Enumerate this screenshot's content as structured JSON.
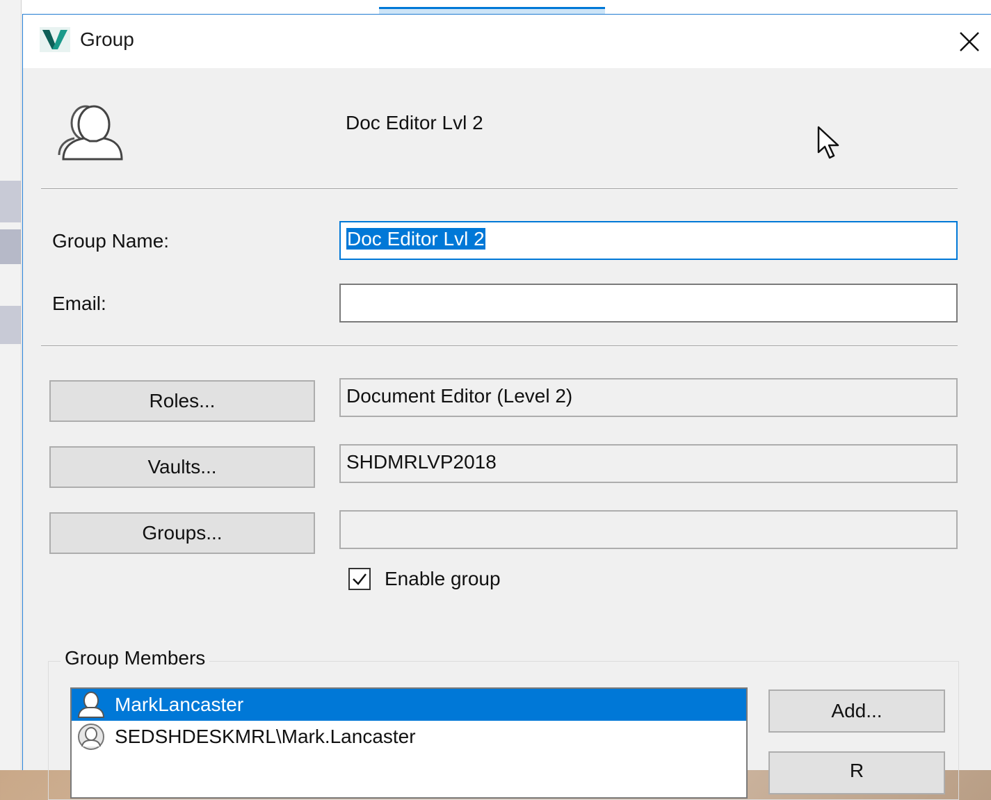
{
  "dialog": {
    "title": "Group",
    "header_name": "Doc Editor Lvl 2"
  },
  "form": {
    "group_name_label": "Group Name:",
    "group_name_value": "Doc Editor Lvl 2",
    "email_label": "Email:",
    "email_value": "",
    "roles_button": "Roles...",
    "roles_value": "Document Editor (Level 2)",
    "vaults_button": "Vaults...",
    "vaults_value": "SHDMRLVP2018",
    "groups_button": "Groups...",
    "groups_value": "",
    "enable_group_label": "Enable group",
    "enable_group_checked": true
  },
  "members": {
    "legend": "Group Members",
    "items": [
      {
        "name": "MarkLancaster",
        "icon": "user-icon",
        "selected": true
      },
      {
        "name": "SEDSHDESKMRL\\Mark.Lancaster",
        "icon": "group-user-icon",
        "selected": false
      }
    ],
    "add_button": "Add...",
    "remove_button_partial": "R"
  },
  "colors": {
    "accent": "#0078d7",
    "dialog_bg": "#f0f0f0",
    "app_icon_teal": "#1a9a8a"
  }
}
